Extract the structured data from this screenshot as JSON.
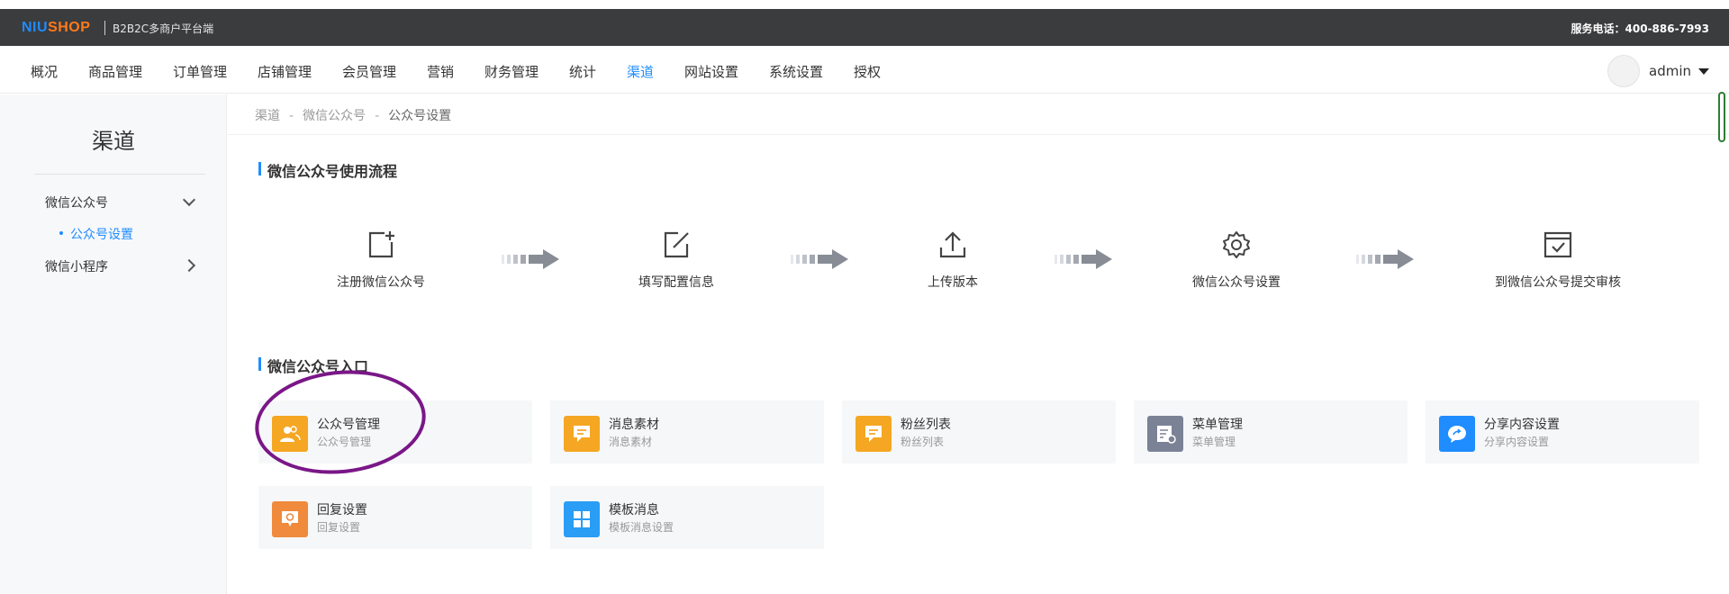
{
  "topbar": {
    "logo_part1": "NIU",
    "logo_part2": "SHOP",
    "subtitle": "B2B2C多商户平台端",
    "service_phone": "服务电话：400-886-7993"
  },
  "nav": {
    "items": [
      "概况",
      "商品管理",
      "订单管理",
      "店铺管理",
      "会员管理",
      "营销",
      "财务管理",
      "统计",
      "渠道",
      "网站设置",
      "系统设置",
      "授权"
    ],
    "active_index": 8,
    "username": "admin"
  },
  "sidebar": {
    "title": "渠道",
    "groups": [
      {
        "label": "微信公众号",
        "expanded": true
      },
      {
        "label": "微信小程序",
        "expanded": false
      }
    ],
    "active_sub": "公众号设置"
  },
  "breadcrumb": [
    "渠道",
    "微信公众号",
    "公众号设置"
  ],
  "flow": {
    "title": "微信公众号使用流程",
    "steps": [
      {
        "label": "注册微信公众号",
        "icon": "add-square-icon"
      },
      {
        "label": "填写配置信息",
        "icon": "edit-icon"
      },
      {
        "label": "上传版本",
        "icon": "upload-icon"
      },
      {
        "label": "微信公众号设置",
        "icon": "gear-icon"
      },
      {
        "label": "到微信公众号提交审核",
        "icon": "calendar-check-icon"
      }
    ]
  },
  "entry": {
    "title": "微信公众号入口",
    "cards": [
      {
        "title": "公众号管理",
        "subtitle": "公众号管理",
        "color": "#f5a623",
        "icon": "users-icon"
      },
      {
        "title": "消息素材",
        "subtitle": "消息素材",
        "color": "#f5a623",
        "icon": "message-icon"
      },
      {
        "title": "粉丝列表",
        "subtitle": "粉丝列表",
        "color": "#f5a623",
        "icon": "fans-icon"
      },
      {
        "title": "菜单管理",
        "subtitle": "菜单管理",
        "color": "#7b8296",
        "icon": "menu-icon"
      },
      {
        "title": "分享内容设置",
        "subtitle": "分享内容设置",
        "color": "#1f8cff",
        "icon": "share-icon"
      },
      {
        "title": "回复设置",
        "subtitle": "回复设置",
        "color": "#f08a3c",
        "icon": "reply-icon"
      },
      {
        "title": "模板消息",
        "subtitle": "模板消息设置",
        "color": "#2a9df4",
        "icon": "template-icon"
      }
    ]
  }
}
